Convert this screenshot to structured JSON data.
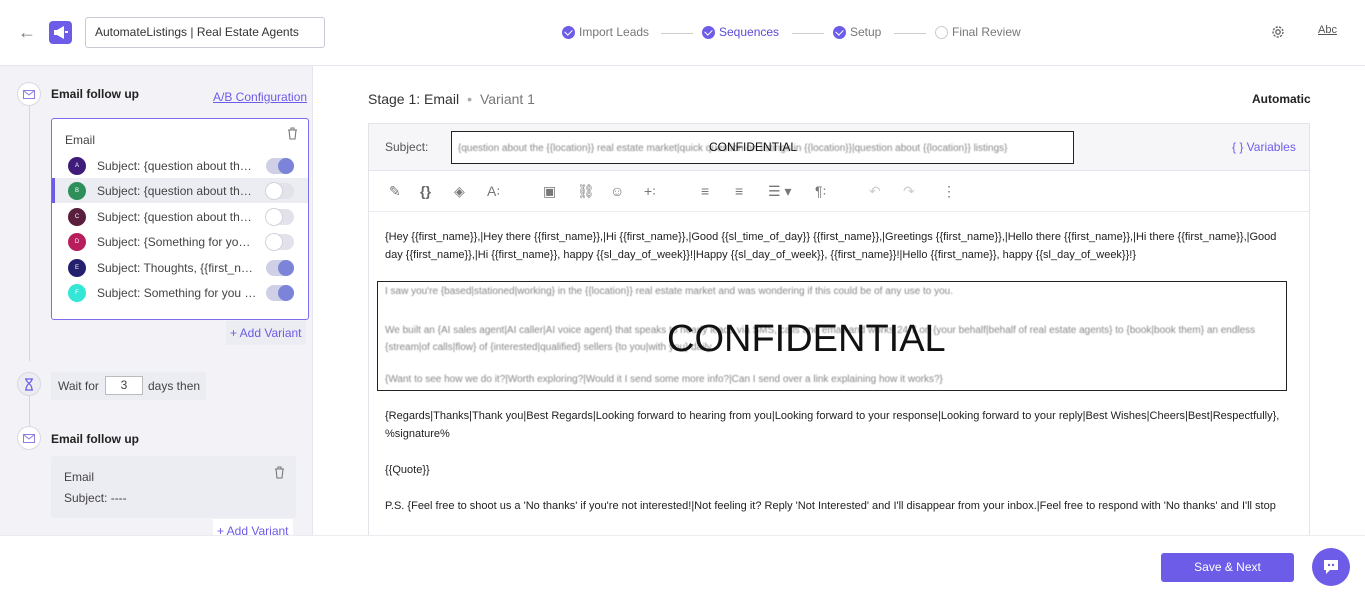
{
  "header": {
    "campaign_name": "AutomateListings | Real Estate Agents",
    "steps": [
      {
        "label": "Import Leads",
        "done": true
      },
      {
        "label": "Sequences",
        "done": true,
        "active": true
      },
      {
        "label": "Setup",
        "done": true
      },
      {
        "label": "Final Review",
        "done": false
      }
    ],
    "abc_label": "Abc"
  },
  "sidebar": {
    "stage1": {
      "title": "Email follow up",
      "ab_config": "A/B Configuration",
      "card_title": "Email",
      "variants": [
        {
          "letter": "A",
          "subject": "Subject: {question about the {{location}} real estate market|quick question about {{location}}}",
          "color": "#3f1c7a",
          "enabled": true
        },
        {
          "letter": "B",
          "subject": "Subject: {question about the {{location}} listings}",
          "color": "#2e8f5a",
          "enabled": false
        },
        {
          "letter": "C",
          "subject": "Subject: {question about the {{location}} market}",
          "color": "#5a1f3c",
          "enabled": false
        },
        {
          "letter": "D",
          "subject": "Subject: {Something for you {{first_name}}}",
          "color": "#b81d5c",
          "enabled": false
        },
        {
          "letter": "E",
          "subject": "Subject: Thoughts, {{first_name}}?",
          "color": "#25206e",
          "enabled": true
        },
        {
          "letter": "F",
          "subject": "Subject: Something for you {{first_name}}",
          "color": "#34e6d6",
          "enabled": true
        }
      ],
      "add_variant": "+ Add Variant"
    },
    "wait": {
      "prefix": "Wait for",
      "days": "3",
      "suffix": "days then"
    },
    "stage2": {
      "title": "Email follow up",
      "card_title": "Email",
      "subject": "Subject: ----",
      "add_variant": "+ Add Variant"
    }
  },
  "main": {
    "stage_title": "Stage 1: Email",
    "variant_label": "Variant 1",
    "mode": "Automatic",
    "subject_label": "Subject:",
    "subject_value": "{question about the {{location}} real estate market|quick question on listings in {{location}}|question about {{location}} listings}",
    "confidential_small": "CONFIDENTIAL",
    "variables_link": "{ } Variables",
    "greeting_line": "{Hey {{first_name}},|Hey there {{first_name}},|Hi {{first_name}},|Good {{sl_time_of_day}} {{first_name}},|Greetings {{first_name}},|Hello there {{first_name}},|Hi there {{first_name}},|Good day {{first_name}},|Hi {{first_name}}, happy {{sl_day_of_week}}!|Happy {{sl_day_of_week}}, {{first_name}}!|Hello {{first_name}}, happy {{sl_day_of_week}}!}",
    "redacted_lines": [
      "I saw you're {based|stationed|working} in the {{location}} real estate market and was wondering if this could be of any use to you.",
      "",
      "We built an {AI sales agent|AI caller|AI voice agent} that speaks to nearly leads via SMS, calls and email and works 24/7 on {your behalf|behalf of real estate agents} to {book|book them} an endless {stream|of calls|flow} of {interested|qualified} sellers {to you|with you} daily.",
      "",
      "{Want to see how we do it?|Worth exploring?|Would it I send some more info?|Can I send over a link explaining how it works?}"
    ],
    "confidential_big": "CONFIDENTIAL",
    "closing_line": "{Regards|Thanks|Thank you|Best Regards|Looking forward to hearing from you|Looking forward to your response|Looking forward to your reply|Best Wishes|Cheers|Best|Respectfully},",
    "signature": "%signature%",
    "quote": "{{Quote}}",
    "ps_line": "P.S. {Feel free to shoot us a 'No thanks' if you're not interested!|Not feeling it? Reply 'Not Interested' and I'll disappear from your inbox.|Feel free to respond with 'No thanks' and I'll stop"
  },
  "footer": {
    "save_label": "Save & Next"
  }
}
